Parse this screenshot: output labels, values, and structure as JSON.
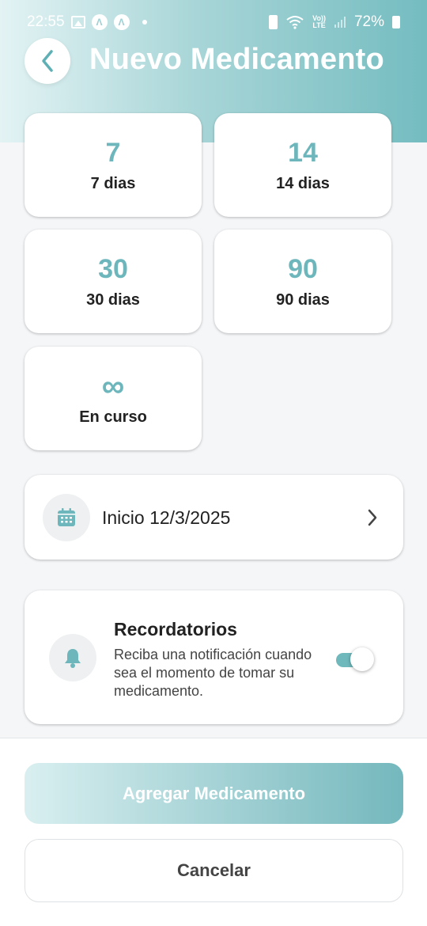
{
  "status_bar": {
    "time": "22:55",
    "battery": "72%",
    "network_top": "Vo))",
    "network_bottom": "LTE"
  },
  "header": {
    "title": "Nuevo Medicamento",
    "back_icon": "chevron-left-icon"
  },
  "durations": [
    {
      "value": "7",
      "label": "7 dias"
    },
    {
      "value": "14",
      "label": "14 dias"
    },
    {
      "value": "30",
      "label": "30 dias"
    },
    {
      "value": "90",
      "label": "90 dias"
    },
    {
      "value": "∞",
      "label": "En curso"
    }
  ],
  "start_date": {
    "label": "Inicio 12/3/2025",
    "icon": "calendar-icon"
  },
  "reminders": {
    "title": "Recordatorios",
    "description": "Reciba una notificación cuando sea el momento de tomar su medicamento.",
    "enabled": true,
    "icon": "bell-icon"
  },
  "actions": {
    "add_label": "Agregar Medicamento",
    "cancel_label": "Cancelar"
  },
  "colors": {
    "accent": "#6db6bb",
    "header_gradient_start": "#e3f3f4",
    "header_gradient_end": "#74bcc0"
  }
}
